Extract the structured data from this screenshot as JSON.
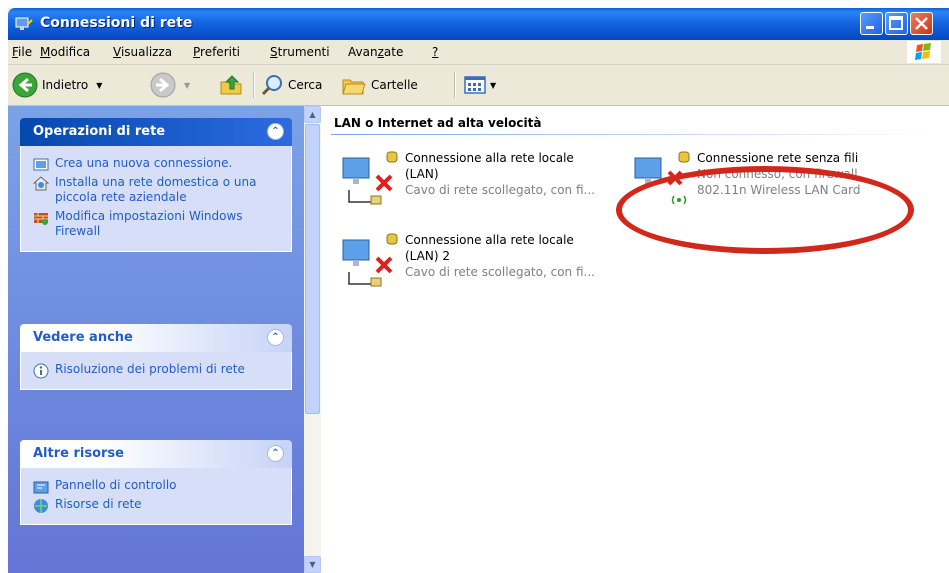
{
  "window": {
    "title": "Connessioni di rete"
  },
  "menu": {
    "items": [
      {
        "accel": "F",
        "rest": "ile"
      },
      {
        "accel": "M",
        "rest": "odifica"
      },
      {
        "accel": "V",
        "rest": "isualizza"
      },
      {
        "accel": "P",
        "rest": "referiti"
      },
      {
        "accel": "S",
        "rest": "trumenti"
      },
      {
        "pre": "Avan",
        "accel": "z",
        "rest": "ate"
      },
      {
        "accel": "?",
        "rest": ""
      }
    ]
  },
  "toolbar": {
    "back_label": "Indietro",
    "search_label": "Cerca",
    "folders_label": "Cartelle"
  },
  "taskpane": {
    "network_tasks": {
      "title": "Operazioni di rete",
      "items": [
        {
          "label": "Crea una nuova connessione.",
          "icon": "new-connection-icon"
        },
        {
          "label": "Installa una rete domestica o una piccola rete aziendale",
          "icon": "home-network-icon"
        },
        {
          "label": "Modifica impostazioni Windows Firewall",
          "icon": "firewall-icon"
        }
      ]
    },
    "see_also": {
      "title": "Vedere anche",
      "items": [
        {
          "label": "Risoluzione dei problemi di rete",
          "icon": "info-icon"
        }
      ]
    },
    "other_places": {
      "title": "Altre risorse",
      "items": [
        {
          "label": "Pannello di controllo",
          "icon": "control-panel-icon"
        },
        {
          "label": "Risorse di rete",
          "icon": "network-places-icon"
        }
      ]
    }
  },
  "content": {
    "group_title": "LAN o Internet ad alta velocità",
    "connections": [
      {
        "name_line1": "Connessione alla rete locale",
        "name_line2": "(LAN)",
        "status": "Cavo di rete scollegato, con fi...",
        "device": ""
      },
      {
        "name_line1": "Connessione alla rete locale",
        "name_line2": "(LAN) 2",
        "status": "Cavo di rete scollegato, con fi...",
        "device": ""
      },
      {
        "name_line1": "Connessione rete senza fili",
        "name_line2": "",
        "status": "Non connesso, con firewall",
        "device": "802.11n Wireless LAN Card"
      }
    ]
  },
  "colors": {
    "titlebar": "#0a52cf",
    "taskpane_link": "#215dc6",
    "highlight_ring": "#d1281b"
  }
}
